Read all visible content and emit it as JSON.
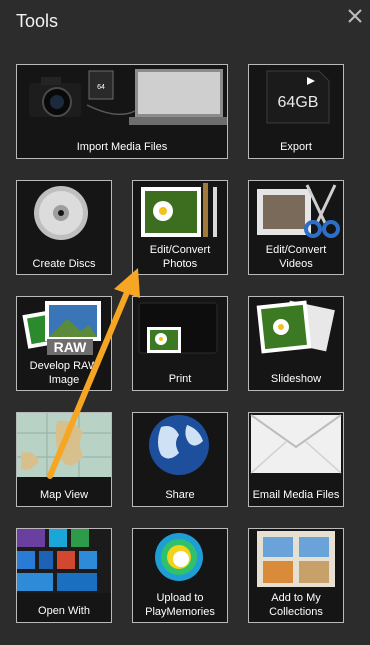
{
  "window": {
    "title": "Tools"
  },
  "tiles": [
    {
      "label": "Import Media Files"
    },
    {
      "label": "Export",
      "card_text": "64GB"
    },
    {
      "label": "Create Discs"
    },
    {
      "label": "Edit/Convert Photos"
    },
    {
      "label": "Edit/Convert Videos"
    },
    {
      "label": "Develop RAW Image",
      "card_text": "RAW"
    },
    {
      "label": "Print"
    },
    {
      "label": "Slideshow"
    },
    {
      "label": "Map View"
    },
    {
      "label": "Share"
    },
    {
      "label": "Email Media Files"
    },
    {
      "label": "Open With"
    },
    {
      "label": "Upload to PlayMemories"
    },
    {
      "label": "Add to My Collections"
    }
  ],
  "colors": {
    "background": "#2c2c2c",
    "tile_border": "#b9b9b9",
    "annotation_arrow": "#f6a623"
  }
}
